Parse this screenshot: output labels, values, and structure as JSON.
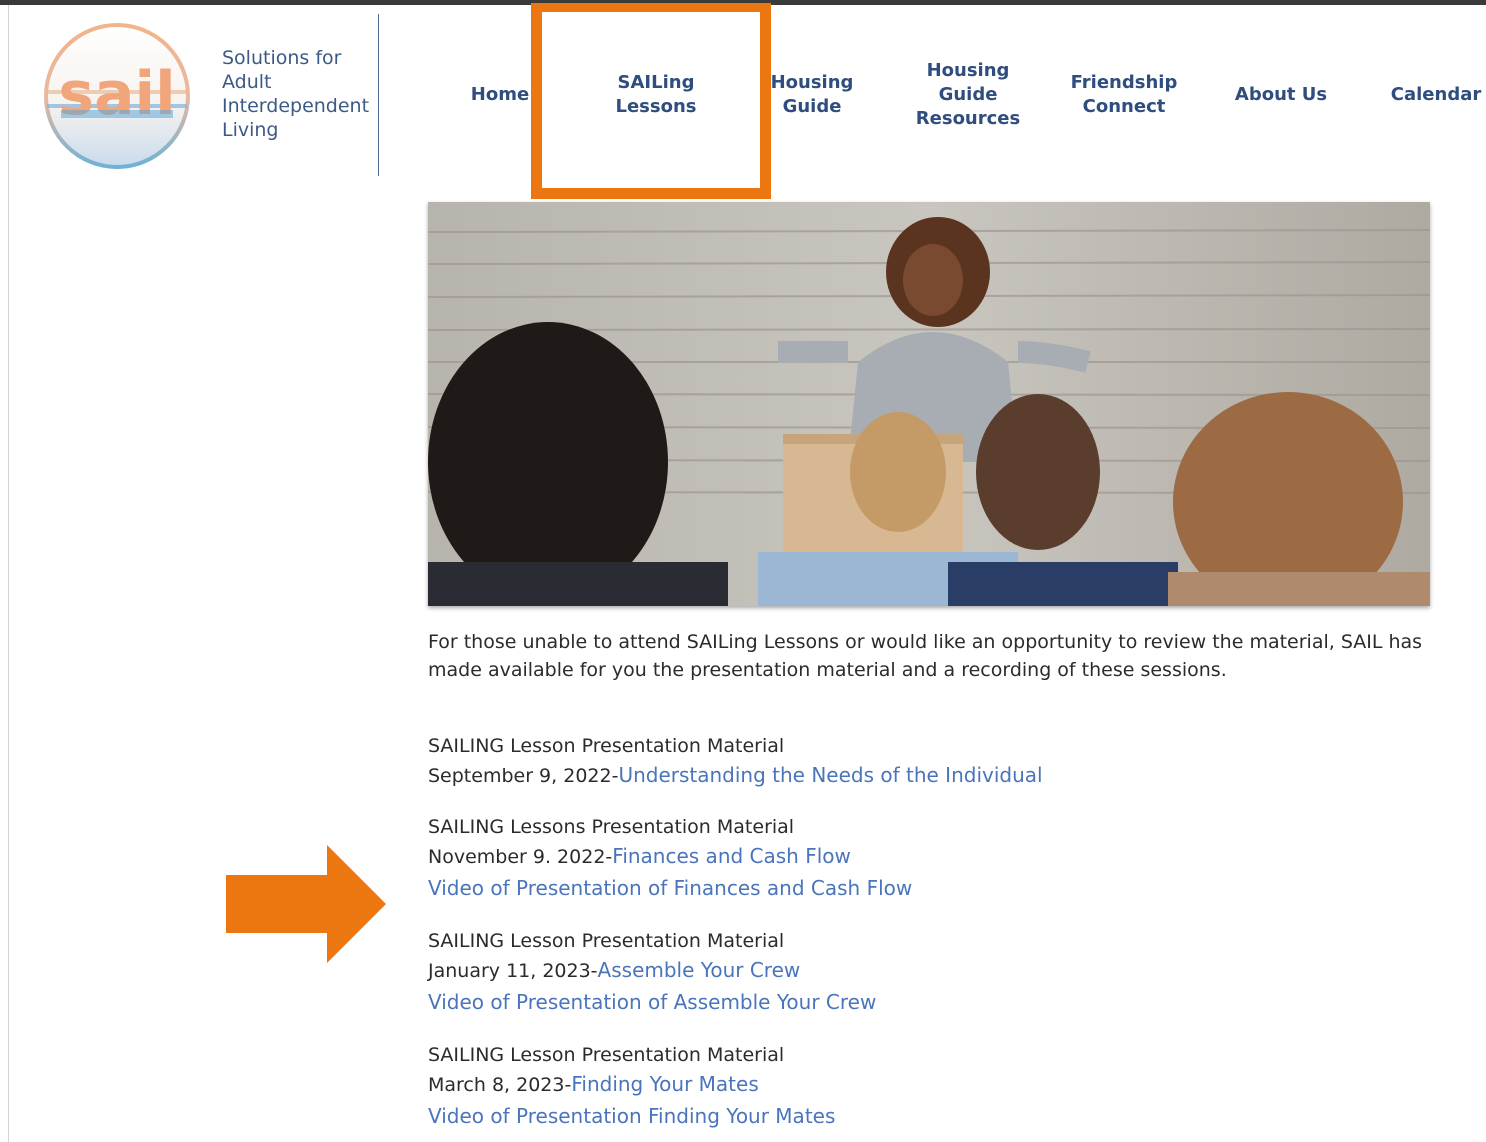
{
  "brand": {
    "logo_text": "sail",
    "tagline": "Solutions for Adult Interdependent Living"
  },
  "nav": {
    "home": "Home",
    "sailing_lessons": "SAILing Lessons",
    "housing_guide": "Housing Guide",
    "housing_guide_resources": "Housing Guide Resources",
    "friendship_connect": "Friendship Connect",
    "about_us": "About Us",
    "calendar": "Calendar"
  },
  "content": {
    "intro": "For those unable to attend SAILing Lessons or would like an opportunity to review the material, SAIL has made available for you the presentation material and a recording of these sessions.",
    "lessons": [
      {
        "heading": "SAILING Lesson Presentation Material",
        "date": "September 9, 2022-",
        "link": "Understanding the Needs of the Individual"
      },
      {
        "heading": "SAILING Lessons Presentation Material",
        "date": "November 9. 2022-",
        "link": "Finances and Cash Flow",
        "video": "Video of Presentation of Finances and Cash Flow"
      },
      {
        "heading": "SAILING Lesson Presentation Material",
        "date": "January 11, 2023-",
        "link": "Assemble Your Crew",
        "video": "Video of Presentation of Assemble Your Crew"
      },
      {
        "heading": "SAILING Lesson Presentation Material",
        "date": "March 8, 2023-",
        "link": "Finding Your Mates",
        "video": "Video of Presentation Finding Your Mates"
      }
    ]
  },
  "colors": {
    "nav_text": "#2f4d7e",
    "link": "#4a74bc",
    "annotation_orange": "#ec7711"
  },
  "icons": {
    "annotation_arrow": "right-arrow-icon"
  }
}
